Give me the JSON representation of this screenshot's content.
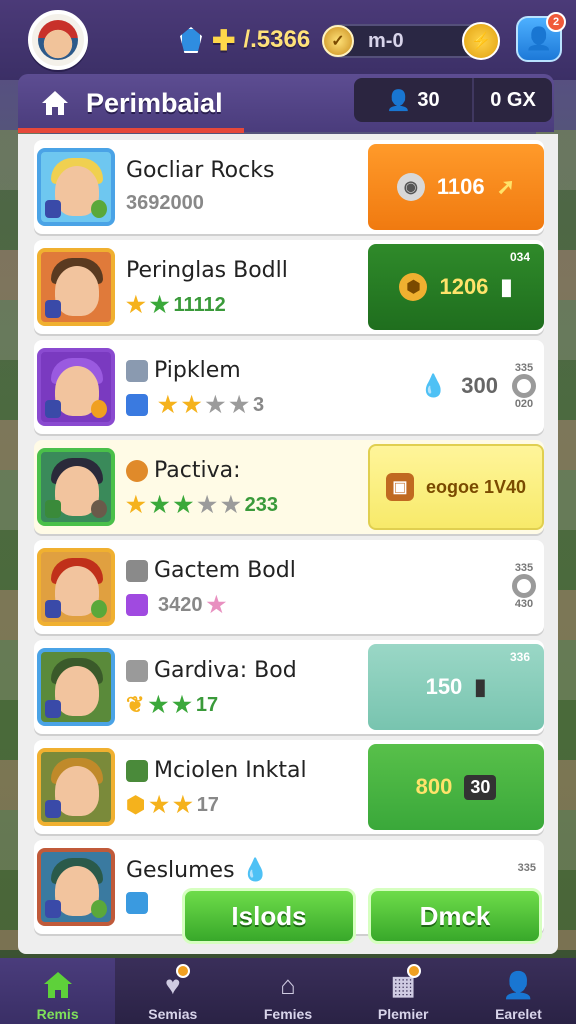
{
  "topbar": {
    "gem_value": "/.5366",
    "coin_label": "m-0",
    "coin_badge": "⚡",
    "profile_badge": "2"
  },
  "header": {
    "title": "Perimbaial",
    "stat_a": "30",
    "stat_b": "0 GX"
  },
  "rows": [
    {
      "name": "Gocliar Rocks",
      "sub": "3692000",
      "action_value": "1106",
      "style": "orange"
    },
    {
      "name": "Peringlas Bodll",
      "sub": "★░░░░ 11112",
      "sub_text": "11112",
      "action_value": "1206",
      "small_label": "034",
      "style": "darkgreen"
    },
    {
      "name": "Pipklem",
      "sub_text": "3",
      "price": "300",
      "mini_top": "335",
      "mini_bot": "020",
      "style": "plain"
    },
    {
      "name": "Pactiva:",
      "sub_text": "233",
      "action_value": "eogoe 1V40",
      "style": "yellow"
    },
    {
      "name": "Gactem Bodl",
      "sub_text": "3420",
      "mini_top": "335",
      "mini_bot": "430",
      "style": "plain-ring"
    },
    {
      "name": "Gardiva: Bod",
      "sub_text": "17",
      "action_value": "150",
      "small_label": "336",
      "style": "teal"
    },
    {
      "name": "Mciolen Inktal",
      "sub_text": "17",
      "action_value": "800",
      "action_value_2": "30",
      "style": "green"
    },
    {
      "name": "Geslumes",
      "sub_text": "",
      "mini_top": "335",
      "style": "plain"
    }
  ],
  "buttons": {
    "left": "Islods",
    "right": "Dmck"
  },
  "nav": [
    {
      "label": "Remis",
      "icon": "home-icon"
    },
    {
      "label": "Semias",
      "icon": "heart-icon"
    },
    {
      "label": "Femies",
      "icon": "house-icon"
    },
    {
      "label": "Plemier",
      "icon": "map-icon"
    },
    {
      "label": "Earelet",
      "icon": "user-icon"
    }
  ]
}
